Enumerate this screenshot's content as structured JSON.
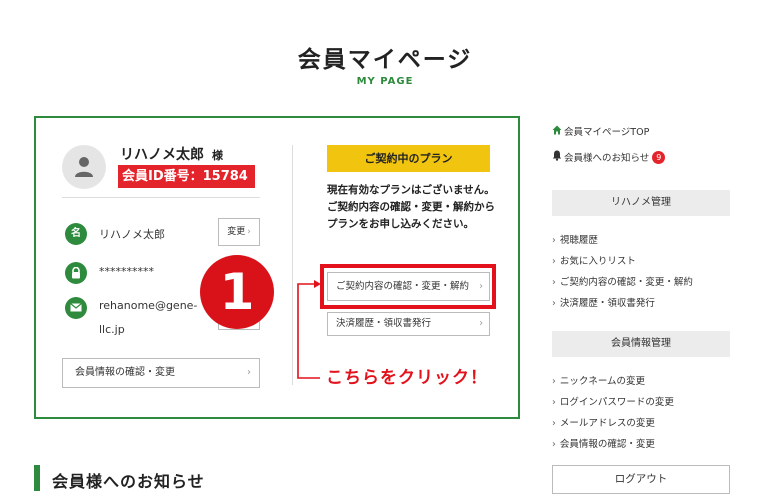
{
  "page": {
    "title": "会員マイページ",
    "subtitle": "MY PAGE"
  },
  "profile": {
    "name": "リハノメ太郎",
    "honorific": "様",
    "member_id": "会員ID番号：15784",
    "nickname_icon": "名",
    "nickname": "リハノメ太郎",
    "password_masked": "**********",
    "email_line1": "rehanome@gene-",
    "email_line2": "llc.jp",
    "change_label": "変更",
    "confirm_label": "会員情報の確認・変更"
  },
  "plan": {
    "header": "ご契約中のプラン",
    "message": "現在有効なプランはございません。ご契約内容の確認・変更・解約からプランをお申し込みください。",
    "contract_button": "ご契約内容の確認・変更・解約",
    "billing_button": "決済履歴・領収書発行"
  },
  "annotation": {
    "step_number": "1",
    "click_note": "こちらをクリック！",
    "color": "#e3111b"
  },
  "sidebar": {
    "top_link": "会員マイページTOP",
    "notice_link": "会員様へのお知らせ",
    "notice_count": "9",
    "section1_title": "リハノメ管理",
    "section1_items": [
      "視聴履歴",
      "お気に入りリスト",
      "ご契約内容の確認・変更・解約",
      "決済履歴・領収書発行"
    ],
    "section2_title": "会員情報管理",
    "section2_items": [
      "ニックネームの変更",
      "ログインパスワードの変更",
      "メールアドレスの変更",
      "会員情報の確認・変更"
    ],
    "logout": "ログアウト"
  },
  "news": {
    "title": "会員様へのお知らせ"
  },
  "colors": {
    "brand_green": "#2e8b3d",
    "plan_yellow": "#f1c40f",
    "id_red": "#e3242b"
  }
}
